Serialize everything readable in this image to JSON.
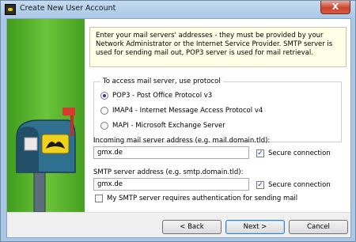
{
  "window": {
    "title": "Create New User Account",
    "close_glyph": "X"
  },
  "info": {
    "text": "Enter your mail servers' addresses - they must be provided by your Network Administrator or the Internet Service Provider. SMTP server is used for sending mail out, POP3 server is used for mail retrieval."
  },
  "protocol": {
    "group_label": "To access mail server, use protocol",
    "options": [
      {
        "label": "POP3 - Post Office Protocol v3",
        "checked": true
      },
      {
        "label": "IMAP4 - Internet Message Access Protocol v4",
        "checked": false
      },
      {
        "label": "MAPI - Microsoft Exchange Server",
        "checked": false
      }
    ]
  },
  "incoming": {
    "label": "Incoming mail server address (e.g. mail.domain.tld):",
    "value": "gmx.de",
    "secure_label": "Secure connection",
    "secure_checked": true
  },
  "smtp": {
    "label": "SMTP server address (e.g. smtp.domain.tld):",
    "value": "gmx.de",
    "secure_label": "Secure connection",
    "secure_checked": true,
    "auth_label": "My SMTP server requires authentication for sending mail",
    "auth_checked": false
  },
  "footer": {
    "back_label": "< Back",
    "next_label": "Next >",
    "cancel_label": "Cancel"
  },
  "colors": {
    "sidebar_green": "#4caf28",
    "info_bg": "#ffffe7",
    "window_frame": "#aac8e6"
  }
}
